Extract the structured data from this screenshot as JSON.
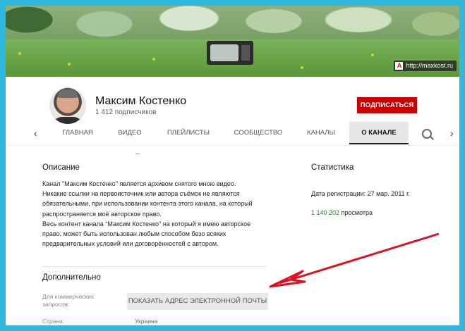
{
  "banner": {
    "watermark": "http://maxkost.ru",
    "watermark_logo": "A"
  },
  "channel": {
    "name": "Максим Костенко",
    "subscribers": "1 412 подписчиков",
    "subscribe_label": "ПОДПИСАТЬСЯ"
  },
  "tabs": [
    {
      "label": "ГЛАВНАЯ",
      "active": false
    },
    {
      "label": "ВИДЕО",
      "active": false
    },
    {
      "label": "ПЛЕЙЛИСТЫ",
      "active": false
    },
    {
      "label": "СООБЩЕСТВО",
      "active": false
    },
    {
      "label": "КАНАЛЫ",
      "active": false
    },
    {
      "label": "О КАНАЛЕ",
      "active": true
    }
  ],
  "nav": {
    "prev_icon": "‹",
    "next_icon": "›"
  },
  "about": {
    "description_heading": "Описание",
    "description_lines": [
      "Канал \"Максим Костенко\" является архивом снятого мною видео.",
      "Никакие ссылки на первоисточник или автора съёмок не являются",
      "обязательными, при использовании контента этого канала, на который",
      "распространяется моё авторское право.",
      "Весь контент канала \"Максим Костенко\" на который я имею авторское",
      "право, может быть использован любым способом безо всяких",
      "предварительных условий или договорённостей с автором."
    ],
    "details_heading": "Дополнительно",
    "business_label": "Для коммерческих запросов:",
    "email_button": "ПОКАЗАТЬ АДРЕС ЭЛЕКТРОННОЙ ПОЧТЫ",
    "country_label": "Страна:",
    "country_value": "Украина"
  },
  "stats": {
    "heading": "Статистика",
    "registered": "Дата регистрации: 27 мар. 2011 г.",
    "views_number": "1 140 202",
    "views_suffix": " просмотра"
  },
  "colors": {
    "border": "#2fb8e0",
    "subscribe": "#cc0000",
    "arrow": "#e01020"
  }
}
